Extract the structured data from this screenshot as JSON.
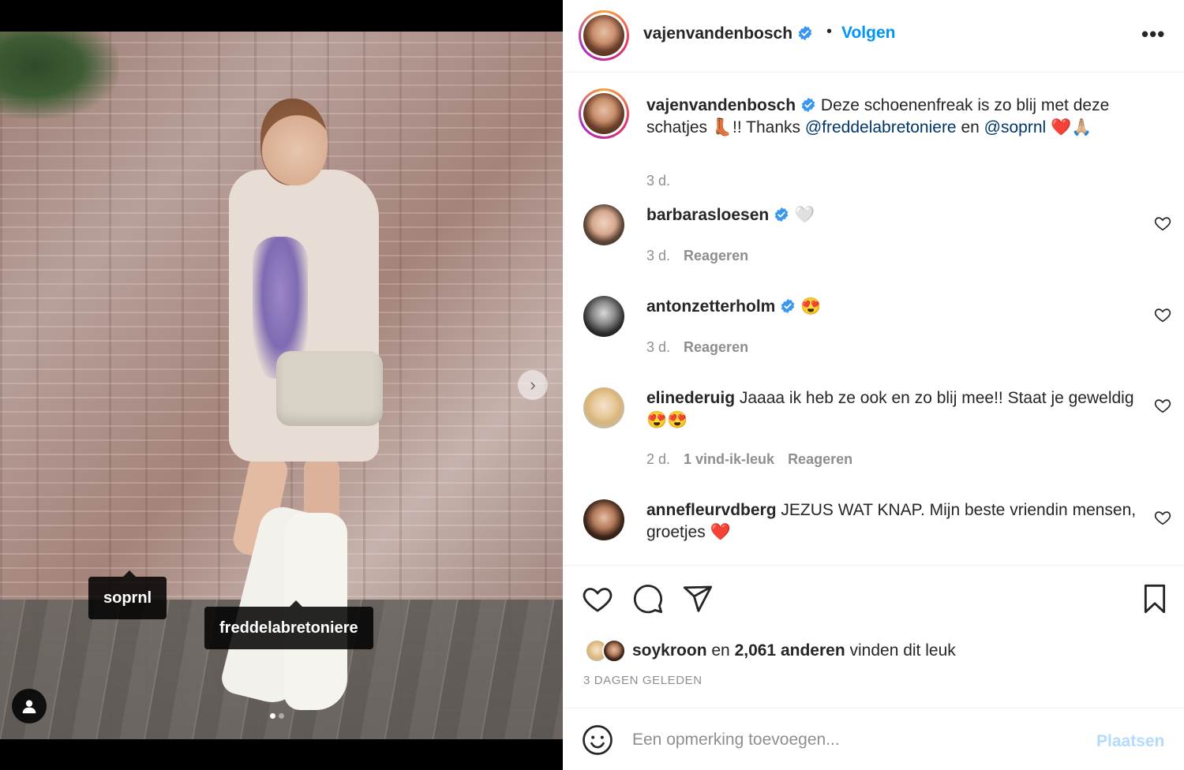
{
  "post": {
    "author": "vajenvandenbosch",
    "follow_label": "Volgen",
    "separator": "•",
    "more_label": "•••",
    "caption": {
      "user": "vajenvandenbosch",
      "text_before": "Deze schoenenfreak is zo blij met deze schatjes 👢!! Thanks ",
      "mention1": "@freddelabretoniere",
      "text_mid": " en ",
      "mention2": "@soprnl",
      "text_after": " ❤️🙏🏼",
      "time": "3 d."
    },
    "photo_tags": [
      "soprnl",
      "freddelabretoniere"
    ],
    "next_arrow": "›",
    "carousel": {
      "count": 2,
      "active": 1
    }
  },
  "comments": [
    {
      "user": "barbarasloesen",
      "verified": true,
      "text": "🤍",
      "time": "3 d.",
      "likes": "",
      "reply": "Reageren"
    },
    {
      "user": "antonzetterholm",
      "verified": true,
      "text": "😍",
      "time": "3 d.",
      "likes": "",
      "reply": "Reageren"
    },
    {
      "user": "elinederuig",
      "verified": false,
      "text": "Jaaaa ik heb ze ook en zo blij mee!! Staat je geweldig 😍😍",
      "time": "2 d.",
      "likes": "1 vind-ik-leuk",
      "reply": "Reageren"
    },
    {
      "user": "annefleurvdberg",
      "verified": false,
      "text": "JEZUS WAT KNAP. Mijn beste vriendin mensen, groetjes ❤️",
      "time": "",
      "likes": "",
      "reply": ""
    }
  ],
  "likes_summary": {
    "user": "soykroon",
    "conj": " en ",
    "others": "2,061 anderen",
    "suffix": " vinden dit leuk"
  },
  "time_ago": "3 DAGEN GELEDEN",
  "add_comment": {
    "placeholder": "Een opmerking toevoegen...",
    "post_label": "Plaatsen"
  },
  "colors": {
    "link_blue": "#0095f6",
    "mention": "#00376b",
    "muted": "#8e8e8e",
    "post_disabled": "#b3dbff"
  },
  "icons": [
    "heart-icon",
    "comment-icon",
    "share-icon",
    "bookmark-icon",
    "emoji-icon",
    "user-tag-icon",
    "verified-badge-icon",
    "chevron-right-icon"
  ]
}
